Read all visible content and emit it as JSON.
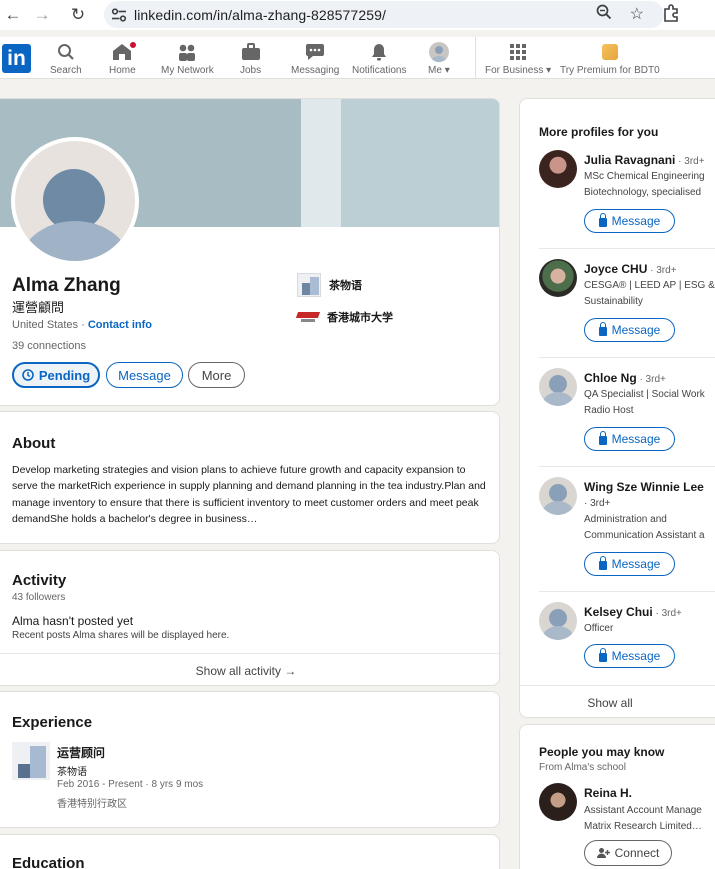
{
  "browser": {
    "url": "linkedin.com/in/alma-zhang-828577259/"
  },
  "nav": {
    "items": [
      {
        "label": "Search",
        "icon": "search-icon"
      },
      {
        "label": "Home",
        "icon": "home-icon"
      },
      {
        "label": "My Network",
        "icon": "network-icon"
      },
      {
        "label": "Jobs",
        "icon": "briefcase-icon"
      },
      {
        "label": "Messaging",
        "icon": "messaging-icon"
      },
      {
        "label": "Notifications",
        "icon": "bell-icon"
      },
      {
        "label": "Me",
        "icon": "avatar-icon"
      },
      {
        "label": "For Business",
        "icon": "grid-icon"
      },
      {
        "label": "Try Premium for BDT0",
        "icon": "premium-icon"
      }
    ],
    "logo_text": "in"
  },
  "profile": {
    "name": "Alma Zhang",
    "headline": "運營顧問",
    "location": "United States · ",
    "contact_info": "Contact info",
    "connections": "39 connections",
    "buttons": {
      "pending": "Pending",
      "message": "Message",
      "more": "More"
    },
    "org_current": "茶物语",
    "org_school": "香港城市大学"
  },
  "about": {
    "title": "About",
    "text": "Develop marketing strategies and vision plans to achieve future growth and capacity expansion to serve the marketRich experience in supply planning and demand planning in the tea industry.Plan and manage inventory to ensure that there is sufficient inventory to meet customer orders and meet peak demandShe holds a bachelor's degree in business…"
  },
  "activity": {
    "title": "Activity",
    "followers": "43 followers",
    "empty_title": "Alma hasn't posted yet",
    "empty_sub": "Recent posts Alma shares will be displayed here.",
    "show_all": "Show all activity →"
  },
  "experience": {
    "title": "Experience",
    "role": "运营顾问",
    "org": "茶物语",
    "dates": "Feb 2016 - Present · 8 yrs 9 mos",
    "location": "香港特别行政区"
  },
  "education": {
    "title": "Education"
  },
  "more_profiles": {
    "title": "More profiles for you",
    "people": [
      {
        "name": "Julia Ravagnani",
        "degree": " · 3rd+",
        "desc1": "MSc Chemical Engineering",
        "desc2": "Biotechnology, specialised",
        "button": "Message"
      },
      {
        "name": "Joyce CHU",
        "degree": " · 3rd+",
        "desc1": "CESGA® | LEED AP | ESG &",
        "desc2": "Sustainability",
        "button": "Message"
      },
      {
        "name": "Chloe Ng",
        "degree": " · 3rd+",
        "desc1": "QA Specialist | Social Work",
        "desc2": "Radio Host",
        "button": "Message"
      },
      {
        "name": "Wing Sze Winnie Lee",
        "degree": "· 3rd+",
        "desc1": "Administration and",
        "desc2": "Communication Assistant a",
        "button": "Message"
      },
      {
        "name": "Kelsey Chui",
        "degree": " · 3rd+",
        "desc1": "Officer",
        "desc2": "",
        "button": "Message"
      }
    ],
    "show_all": "Show all"
  },
  "pymk": {
    "title": "People you may know",
    "subtitle": "From Alma's school",
    "person": {
      "name": "Reina H.",
      "desc1": "Assistant Account Manage",
      "desc2": "Matrix Research Limited…",
      "button": "Connect"
    }
  },
  "colors": {
    "brand": "#0a66c2",
    "background": "#f4f2ee",
    "notification": "#cb112d"
  }
}
